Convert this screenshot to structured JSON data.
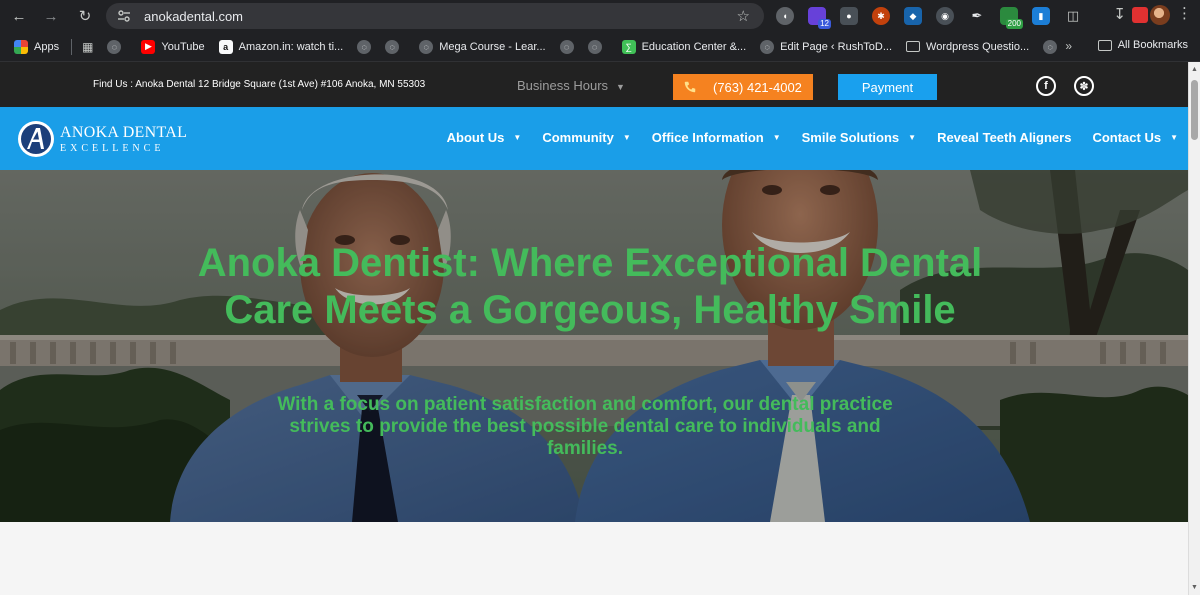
{
  "browser": {
    "url": "anokadental.com",
    "bookmarks": [
      {
        "label": "Apps"
      },
      {
        "label": "YouTube"
      },
      {
        "label": "Amazon.in: watch ti..."
      },
      {
        "label": "Mega Course - Lear..."
      },
      {
        "label": "Education Center &..."
      },
      {
        "label": "Edit Page ‹ RushToD..."
      },
      {
        "label": "Wordpress Questio..."
      }
    ],
    "more_label": "»",
    "all_bookmarks": "All Bookmarks",
    "extension_badges": {
      "ext2": "12",
      "ext8": "200"
    }
  },
  "topbar": {
    "address": "Find Us : Anoka Dental 12 Bridge Square (1st Ave) #106 Anoka, MN 55303",
    "hours_label": "Business Hours",
    "phone": "(763) 421-4002",
    "payment_label": "Payment",
    "colors": {
      "phone_bg": "#f58220",
      "payment_bg": "#19a0ee"
    }
  },
  "nav": {
    "logo_line1": "ANOKA DENTAL",
    "logo_line2": "EXCELLENCE",
    "items": [
      {
        "label": "About Us",
        "has_dropdown": true
      },
      {
        "label": "Community",
        "has_dropdown": true
      },
      {
        "label": "Office Information",
        "has_dropdown": true
      },
      {
        "label": "Smile Solutions",
        "has_dropdown": true
      },
      {
        "label": "Reveal Teeth Aligners",
        "has_dropdown": false
      },
      {
        "label": "Contact Us",
        "has_dropdown": true
      }
    ],
    "color": "#1a9ee8"
  },
  "hero": {
    "title": "Anoka Dentist: Where Exceptional Dental Care Meets a Gorgeous, Healthy Smile",
    "subtitle": "With a focus on patient satisfaction and comfort, our dental practice strives to provide the best possible dental care to individuals and families.",
    "text_color": "#44bb5b"
  }
}
